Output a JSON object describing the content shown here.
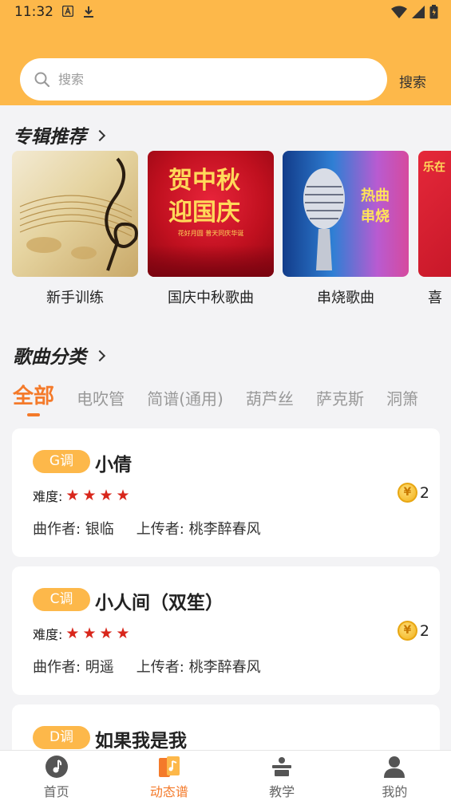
{
  "status_bar": {
    "time": "11:32"
  },
  "search": {
    "placeholder": "搜索",
    "button_label": "搜索"
  },
  "albums_section": {
    "title": "专辑推荐",
    "items": [
      {
        "title": "新手训练"
      },
      {
        "title": "国庆中秋歌曲",
        "cover_text_1": "贺中秋",
        "cover_text_2": "迎国庆",
        "cover_caption": "花好月圆 普天同庆华诞"
      },
      {
        "title": "串烧歌曲",
        "cover_text_1": "热曲",
        "cover_text_2": "串烧"
      },
      {
        "title": "喜",
        "cover_text_1": "乐在"
      }
    ]
  },
  "categories_section": {
    "title": "歌曲分类",
    "tabs": [
      "全部",
      "电吹管",
      "简谱(通用)",
      "葫芦丝",
      "萨克斯",
      "洞箫"
    ]
  },
  "songs": [
    {
      "key": "G调",
      "title": "小倩",
      "difficulty_label": "难度:",
      "stars": "★★★★",
      "price": "2",
      "composer": "曲作者: 银临",
      "uploader": "上传者: 桃李醉春风"
    },
    {
      "key": "C调",
      "title": "小人间（双笙）",
      "difficulty_label": "难度:",
      "stars": "★★★★",
      "price": "2",
      "composer": "曲作者: 明遥",
      "uploader": "上传者: 桃李醉春风"
    },
    {
      "key": "D调",
      "title": "如果我是我"
    }
  ],
  "coin_symbol": "¥",
  "bottom_nav": [
    {
      "label": "首页",
      "icon": "music-note-icon"
    },
    {
      "label": "动态谱",
      "icon": "sheet-music-icon"
    },
    {
      "label": "教学",
      "icon": "teaching-icon"
    },
    {
      "label": "我的",
      "icon": "person-icon"
    }
  ],
  "colors": {
    "brand": "#fdb84a",
    "accent": "#f47a2a",
    "star": "#d8261b"
  }
}
